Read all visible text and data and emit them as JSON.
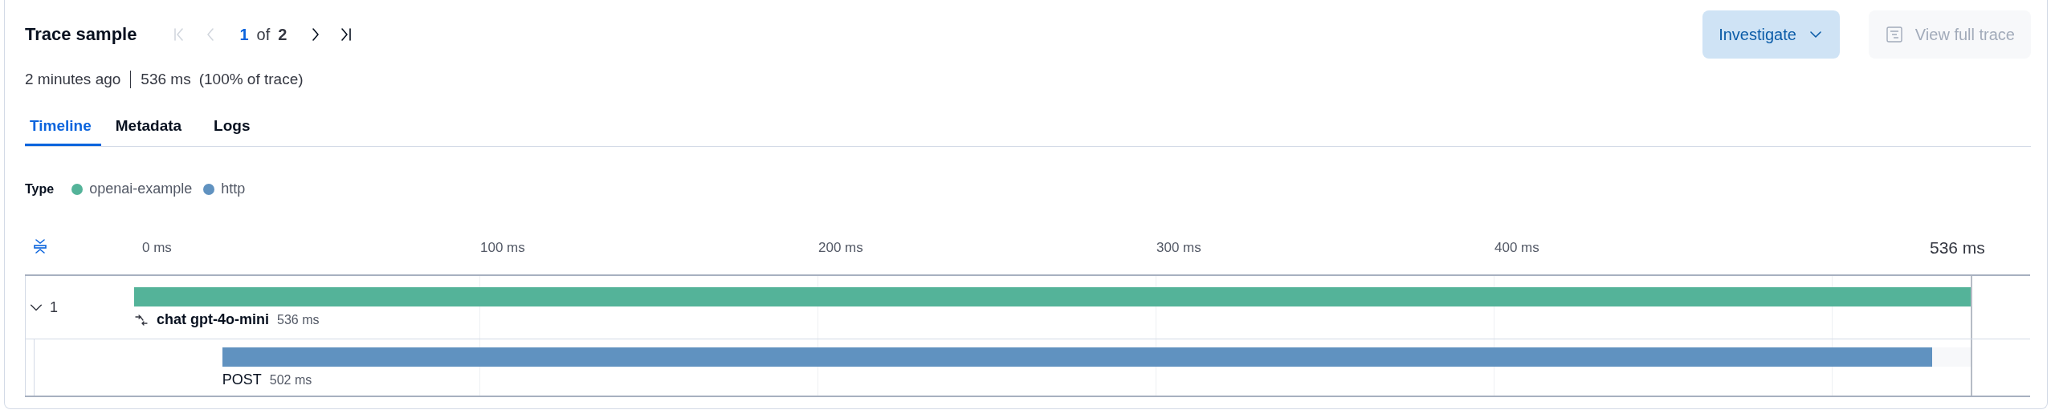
{
  "header": {
    "title": "Trace sample",
    "pager_buttons": [
      {
        "kind": "first",
        "disabled": true
      },
      {
        "kind": "prev",
        "disabled": true
      },
      {
        "kind": "next",
        "disabled": false
      },
      {
        "kind": "last",
        "disabled": false
      }
    ],
    "current": "1",
    "of": "of",
    "total": "2"
  },
  "actions": [
    {
      "label": "Investigate",
      "kind": "menu",
      "disabled": false
    },
    {
      "label": "View full trace",
      "kind": "document",
      "disabled": true
    }
  ],
  "summary": {
    "age": "2 minutes ago",
    "duration": "536 ms",
    "share": "(100% of trace)"
  },
  "tabs": [
    {
      "label": "Timeline",
      "selected": true
    },
    {
      "label": "Metadata",
      "selected": false
    },
    {
      "label": "Logs",
      "selected": false
    }
  ],
  "legend": {
    "label": "Type",
    "items": [
      {
        "name": "openai-example",
        "color": "#54b399"
      },
      {
        "name": "http",
        "color": "#6092c0"
      }
    ]
  },
  "axis": {
    "ticks": [
      "0 ms",
      "100 ms",
      "200 ms",
      "300 ms",
      "400 ms"
    ],
    "end": "536 ms"
  },
  "spans": [
    {
      "name": "chat gpt-4o-mini",
      "duration": "536 ms",
      "color": "#54b399",
      "level": 1,
      "kind": "llm",
      "expanded": true,
      "child_count": "1",
      "children": [
        {
          "name": "POST",
          "duration": "502 ms",
          "color": "#6092c0",
          "level": 0.978,
          "kind": "plain"
        }
      ]
    }
  ]
}
